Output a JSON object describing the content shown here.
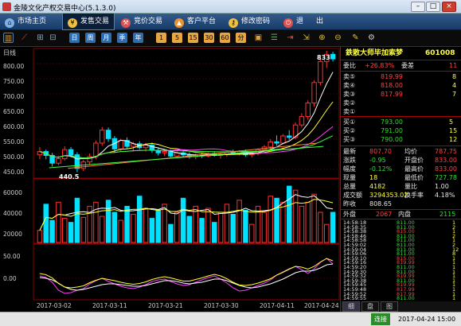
{
  "window": {
    "title": "金陵文化产权交易中心(5.1.3.0)",
    "min": "–",
    "max": "□",
    "close": "×"
  },
  "menu": [
    {
      "label": "市场主页",
      "icon": "home-icon",
      "color": "#7fb0e8"
    },
    {
      "label": "发售交易",
      "icon": "yen-icon",
      "color": "#f0c040",
      "active": true
    },
    {
      "label": "竞价交易",
      "icon": "auction-icon",
      "color": "#e05050"
    },
    {
      "label": "客户平台",
      "icon": "client-icon",
      "color": "#f09030"
    },
    {
      "label": "修改密码",
      "icon": "key-icon",
      "color": "#f0c040"
    },
    {
      "label": "退",
      "icon": "power-icon",
      "color": "#e05050"
    },
    {
      "label": "出",
      "icon": "",
      "color": ""
    }
  ],
  "toolbar": {
    "blue": [
      "日",
      "周",
      "月",
      "季",
      "年"
    ],
    "orange": [
      "1",
      "5",
      "15",
      "30",
      "60",
      "分"
    ],
    "icons": [
      "bar-chart-icon",
      "line-icon",
      "grid-icon",
      "minus-icon",
      "plus-icon",
      "window-icon",
      "list-icon",
      "exit-icon",
      "zoom-in-icon",
      "zoom-out-icon",
      "pointer-icon",
      "settings-icon"
    ]
  },
  "chart": {
    "period_label": "日线",
    "price_axis": [
      "800.00",
      "750.00",
      "700.00",
      "650.00",
      "600.00",
      "550.00",
      "500.00",
      "450.00"
    ],
    "low_label": "440.5",
    "high_label": "833",
    "volume_axis": [
      "60000",
      "40000",
      "20000"
    ],
    "macd_axis": [
      "50.00",
      "0.00"
    ],
    "date_labels": [
      "2017-03-02",
      "2017-03-11",
      "2017-03-21",
      "2017-03-30",
      "2017-04-11",
      "2017-04-24"
    ],
    "colors": {
      "up": "#ff3030",
      "down": "#00e0ff",
      "ma5": "#ffffff",
      "ma10": "#ffff30",
      "ma20": "#ff40ff",
      "ma60": "#30ff30",
      "trend": "#ff8030"
    }
  },
  "chart_data": {
    "type": "candlestick",
    "title": "",
    "xlabel": "",
    "ylabel": "",
    "ylim": [
      440,
      840
    ],
    "ohlc": [
      [
        512,
        536,
        498,
        522
      ],
      [
        522,
        528,
        498,
        510
      ],
      [
        510,
        518,
        476,
        486
      ],
      [
        486,
        508,
        480,
        500
      ],
      [
        500,
        538,
        494,
        528
      ],
      [
        528,
        536,
        504,
        512
      ],
      [
        512,
        520,
        458,
        470
      ],
      [
        470,
        496,
        462,
        490
      ],
      [
        490,
        516,
        482,
        506
      ],
      [
        506,
        556,
        498,
        548
      ],
      [
        548,
        598,
        540,
        588
      ],
      [
        588,
        596,
        552,
        562
      ],
      [
        562,
        570,
        518,
        530
      ],
      [
        530,
        562,
        524,
        556
      ],
      [
        556,
        566,
        530,
        538
      ],
      [
        538,
        552,
        522,
        546
      ],
      [
        546,
        554,
        528,
        534
      ],
      [
        534,
        548,
        522,
        542
      ],
      [
        542,
        550,
        518,
        526
      ],
      [
        526,
        534,
        510,
        518
      ],
      [
        518,
        530,
        508,
        522
      ],
      [
        522,
        528,
        504,
        508
      ],
      [
        508,
        522,
        504,
        518
      ],
      [
        518,
        524,
        506,
        512
      ],
      [
        512,
        520,
        500,
        506
      ],
      [
        506,
        516,
        498,
        512
      ],
      [
        512,
        518,
        502,
        508
      ],
      [
        508,
        520,
        504,
        516
      ],
      [
        516,
        522,
        506,
        510
      ],
      [
        510,
        518,
        500,
        514
      ],
      [
        514,
        524,
        506,
        520
      ],
      [
        520,
        528,
        512,
        516
      ],
      [
        516,
        526,
        510,
        522
      ],
      [
        522,
        528,
        506,
        512
      ],
      [
        512,
        520,
        504,
        516
      ],
      [
        516,
        532,
        510,
        528
      ],
      [
        528,
        542,
        522,
        536
      ],
      [
        536,
        560,
        530,
        552
      ],
      [
        552,
        572,
        540,
        548
      ],
      [
        548,
        576,
        544,
        570
      ],
      [
        570,
        588,
        558,
        566
      ],
      [
        566,
        612,
        560,
        604
      ],
      [
        604,
        640,
        596,
        630
      ],
      [
        630,
        680,
        620,
        672
      ],
      [
        672,
        742,
        660,
        735
      ],
      [
        735,
        812,
        726,
        800
      ],
      [
        800,
        833,
        780,
        822
      ],
      [
        822,
        830,
        800,
        808
      ]
    ],
    "volume": [
      12,
      38,
      22,
      40,
      24,
      20,
      44,
      25,
      36,
      40,
      26,
      42,
      30,
      22,
      36,
      28,
      46,
      34,
      24,
      32,
      38,
      18,
      30,
      44,
      26,
      36,
      24,
      34,
      20,
      30,
      38,
      28,
      42,
      32,
      18,
      36,
      30,
      46,
      44,
      40,
      56,
      52,
      36,
      40,
      48,
      30,
      18,
      30
    ],
    "macd_dif": [
      6,
      2,
      -10,
      -30,
      -38,
      -36,
      -30,
      -26,
      -14,
      -6,
      0,
      -8,
      -14,
      -20,
      -24,
      -26,
      -22,
      -16,
      -8,
      -4,
      -2,
      -8,
      -14,
      -18,
      -16,
      -10,
      -4,
      2,
      6,
      -2,
      -12,
      -24,
      -32,
      -30,
      -24,
      -18,
      -12,
      -4,
      8,
      16,
      24,
      30,
      22,
      12,
      24,
      40,
      50,
      36
    ],
    "macd_dea": [
      2,
      0,
      -4,
      -12,
      -22,
      -28,
      -30,
      -28,
      -24,
      -20,
      -16,
      -14,
      -14,
      -16,
      -18,
      -20,
      -20,
      -18,
      -14,
      -10,
      -6,
      -6,
      -8,
      -12,
      -14,
      -12,
      -10,
      -6,
      -2,
      -2,
      -6,
      -12,
      -18,
      -22,
      -24,
      -22,
      -18,
      -14,
      -8,
      -2,
      6,
      14,
      18,
      18,
      20,
      26,
      34,
      36
    ]
  },
  "panel": {
    "stock_title": "鉄散大师毕加索梦",
    "stock_code": "601008",
    "weibi_label": "委比",
    "weibi_value": "+26.83%",
    "weicha_label": "委差",
    "weicha_value": "11",
    "sells": [
      {
        "label": "卖⑤",
        "price": "819.99",
        "qty": "8"
      },
      {
        "label": "卖④",
        "price": "818.00",
        "qty": "4"
      },
      {
        "label": "卖③",
        "price": "817.99",
        "qty": "7"
      },
      {
        "label": "卖②",
        "price": "",
        "qty": ""
      },
      {
        "label": "卖①",
        "price": "",
        "qty": ""
      }
    ],
    "buys": [
      {
        "label": "买①",
        "price": "793.00",
        "qty": "5"
      },
      {
        "label": "买②",
        "price": "791.00",
        "qty": "15"
      },
      {
        "label": "买③",
        "price": "790.00",
        "qty": "12"
      }
    ],
    "quotes": [
      {
        "l1": "最新",
        "v1": "807.70",
        "l2": "均价",
        "v2": "787.75",
        "c1": "red",
        "c2": "red"
      },
      {
        "l1": "涨跌",
        "v1": "-0.95",
        "l2": "开盘价",
        "v2": "833.00",
        "c1": "green",
        "c2": "red"
      },
      {
        "l1": "幅度",
        "v1": "-0.12%",
        "l2": "最高价",
        "v2": "833.00",
        "c1": "green",
        "c2": "red"
      },
      {
        "l1": "现量",
        "v1": "18",
        "l2": "最低价",
        "v2": "727.78",
        "c1": "yel",
        "c2": "green"
      },
      {
        "l1": "总量",
        "v1": "4182",
        "l2": "量比",
        "v2": "1.00",
        "c1": "yel",
        "c2": "wht"
      },
      {
        "l1": "成交额",
        "v1": "3294353.02",
        "l2": "换手率",
        "v2": "4.18%",
        "c1": "yel",
        "c2": "wht"
      },
      {
        "l1": "昨收",
        "v1": "808.65",
        "l2": "",
        "v2": "",
        "c1": "wht",
        "c2": "wht"
      }
    ],
    "waipan_label": "外盘",
    "waipan_value": "2067",
    "neipan_label": "内盘",
    "neipan_value": "2115",
    "ticks": [
      {
        "time": "14:58:18",
        "price": "811.00",
        "qty": "1"
      },
      {
        "time": "14:58:35",
        "price": "811.00",
        "qty": "2"
      },
      {
        "time": "14:58:38",
        "price": "815.00",
        "qty": "1"
      },
      {
        "time": "14:58:46",
        "price": "811.00",
        "qty": "2"
      },
      {
        "time": "14:58:58",
        "price": "811.00",
        "qty": "1"
      },
      {
        "time": "14:59:02",
        "price": "811.00",
        "qty": "2"
      },
      {
        "time": "14:59:04",
        "price": "811.00",
        "qty": "12"
      },
      {
        "time": "14:59:06",
        "price": "811.00",
        "qty": "8"
      },
      {
        "time": "14:59:10",
        "price": "815.00",
        "qty": "1"
      },
      {
        "time": "14:59:16",
        "price": "819.99",
        "qty": "1"
      },
      {
        "time": "14:59:20",
        "price": "811.00",
        "qty": "1"
      },
      {
        "time": "14:59:30",
        "price": "811.00",
        "qty": "1"
      },
      {
        "time": "14:59:32",
        "price": "819.99",
        "qty": "1"
      },
      {
        "time": "14:59:38",
        "price": "811.00",
        "qty": "1"
      },
      {
        "time": "14:59:45",
        "price": "819.99",
        "qty": "1"
      },
      {
        "time": "14:59:48",
        "price": "817.99",
        "qty": "1"
      },
      {
        "time": "14:59:52",
        "price": "817.99",
        "qty": "1"
      },
      {
        "time": "14:59:55",
        "price": "811.00",
        "qty": "1"
      }
    ],
    "tabs": [
      "细",
      "盘",
      "图"
    ]
  },
  "status": {
    "connection": "连接",
    "datetime": "2017-04-24 15:00"
  }
}
